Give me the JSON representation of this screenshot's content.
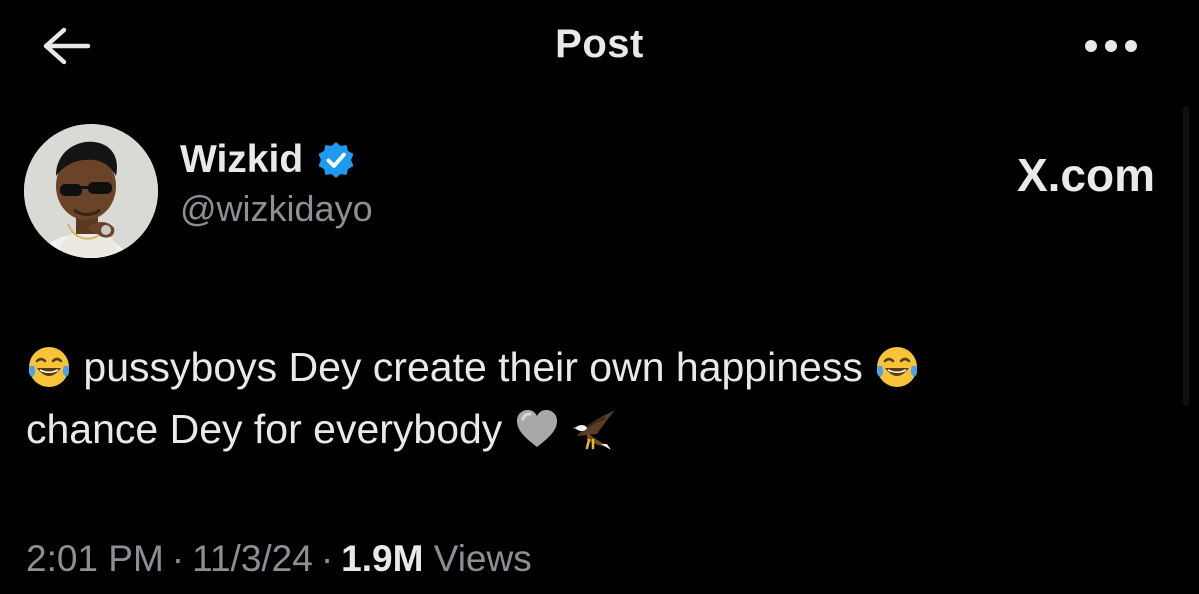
{
  "header": {
    "title": "Post",
    "back_icon": "arrow-left-icon",
    "more_icon": "more-horizontal-icon"
  },
  "author": {
    "display_name": "Wizkid",
    "handle": "@wizkidayo",
    "verified_icon": "verified-badge-icon",
    "verified_color": "#1d9bf0"
  },
  "watermark": "X.com",
  "post": {
    "line1_text": "pussyboys Dey create their own happiness",
    "line2_text": "chance Dey for everybody",
    "emojis": [
      "joy-tears-emoji",
      "joy-tears-emoji",
      "grey-heart-emoji",
      "eagle-emoji"
    ]
  },
  "meta": {
    "time": "2:01 PM",
    "date": "11/3/24",
    "separator": "·",
    "views_count": "1.9M",
    "views_label": "Views"
  },
  "colors": {
    "background": "#000000",
    "primary_text": "#e7e9ea",
    "secondary_text": "#8b9095"
  }
}
